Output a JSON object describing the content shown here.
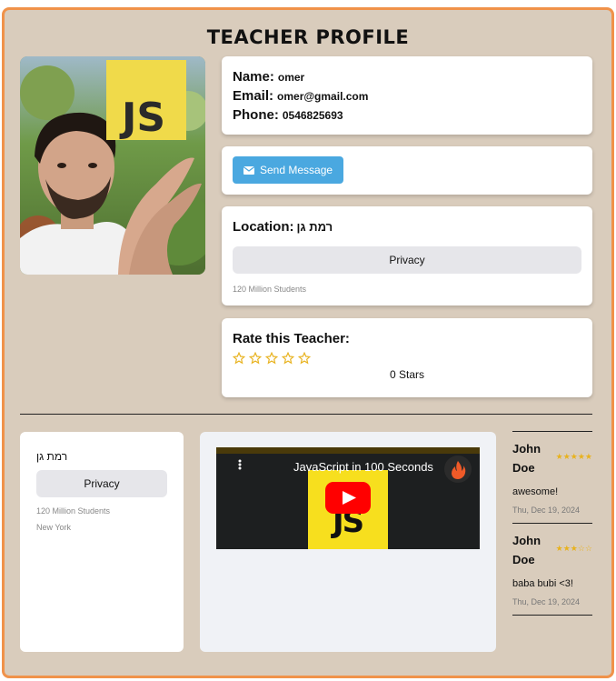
{
  "header": {
    "title": "Teacher Profile"
  },
  "photo": {
    "badge_text": "JS"
  },
  "contact": {
    "name_label": "Name:",
    "name": "omer",
    "email_label": "Email:",
    "email": "omer@gmail.com",
    "phone_label": "Phone:",
    "phone": "0546825693"
  },
  "message": {
    "send_label": "Send Message",
    "icon": "envelope-icon"
  },
  "location": {
    "label": "Location:",
    "value": "רמת גן",
    "privacy_label": "Privacy",
    "students": "120 Million Students"
  },
  "rating": {
    "label": "Rate this Teacher:",
    "stars_max": 5,
    "stars_selected": 0,
    "count_text": "0 Stars",
    "star_color": "#e8b21e"
  },
  "side_card": {
    "location": "רמת גן",
    "privacy_label": "Privacy",
    "students": "120 Million Students",
    "city": "New York"
  },
  "video": {
    "title": "JavaScript in 100 Seconds",
    "thumb_text": "JS"
  },
  "reviews": [
    {
      "name": "John Doe",
      "stars": "★★★★★",
      "text": "awesome!",
      "date": "Thu, Dec 19, 2024"
    },
    {
      "name": "John Doe",
      "stars": "★★★☆☆",
      "text": "baba bubi <3!",
      "date": "Thu, Dec 19, 2024"
    }
  ],
  "colors": {
    "frame_bg": "#d9ccbc",
    "frame_border": "#f0924a",
    "button_blue": "#4aa8e0"
  }
}
